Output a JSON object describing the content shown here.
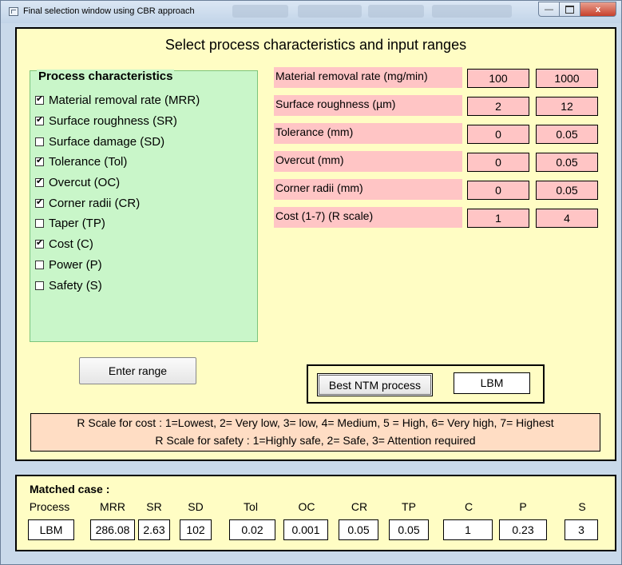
{
  "window": {
    "title": "Final selection window using CBR approach",
    "close_glyph": "x"
  },
  "main": {
    "heading": "Select process characteristics and input ranges"
  },
  "process_characteristics": {
    "legend": "Process characteristics",
    "items": [
      {
        "label": "Material removal rate (MRR)",
        "checked": true
      },
      {
        "label": "Surface roughness (SR)",
        "checked": true
      },
      {
        "label": "Surface damage (SD)",
        "checked": false
      },
      {
        "label": "Tolerance (Tol)",
        "checked": true
      },
      {
        "label": "Overcut (OC)",
        "checked": true
      },
      {
        "label": "Corner radii (CR)",
        "checked": true
      },
      {
        "label": "Taper (TP)",
        "checked": false
      },
      {
        "label": "Cost (C)",
        "checked": true
      },
      {
        "label": "Power (P)",
        "checked": false
      },
      {
        "label": "Safety (S)",
        "checked": false
      }
    ]
  },
  "ranges": [
    {
      "label": "Material removal rate (mg/min)",
      "min": "100",
      "max": "1000"
    },
    {
      "label": "Surface roughness (µm)",
      "min": "2",
      "max": "12"
    },
    {
      "label": "Tolerance (mm)",
      "min": "0",
      "max": "0.05"
    },
    {
      "label": "Overcut (mm)",
      "min": "0",
      "max": "0.05"
    },
    {
      "label": "Corner radii (mm)",
      "min": "0",
      "max": "0.05"
    },
    {
      "label": "Cost (1-7) (R scale)",
      "min": "1",
      "max": "4"
    }
  ],
  "buttons": {
    "enter_range": "Enter range",
    "best_ntm": "Best NTM process"
  },
  "best_result": "LBM",
  "scale_notes": {
    "cost": "R Scale for cost : 1=Lowest, 2= Very low, 3= low, 4= Medium, 5 = High, 6= Very high, 7= Highest",
    "safety": "R Scale for safety : 1=Highly safe, 2= Safe, 3= Attention required"
  },
  "matched_case": {
    "title": "Matched case :",
    "headers": [
      "Process",
      "MRR",
      "SR",
      "SD",
      "Tol",
      "OC",
      "CR",
      "TP",
      "C",
      "P",
      "S"
    ],
    "values": [
      "LBM",
      "286.08",
      "2.63",
      "102",
      "0.02",
      "0.001",
      "0.05",
      "0.05",
      "1",
      "0.23",
      "3"
    ]
  },
  "colors": {
    "main_panel_bg": "#fffdc4",
    "process_box_bg": "#c9f6c9",
    "range_label_bg": "#ffc5c5",
    "scale_box_bg": "#ffddc4"
  }
}
